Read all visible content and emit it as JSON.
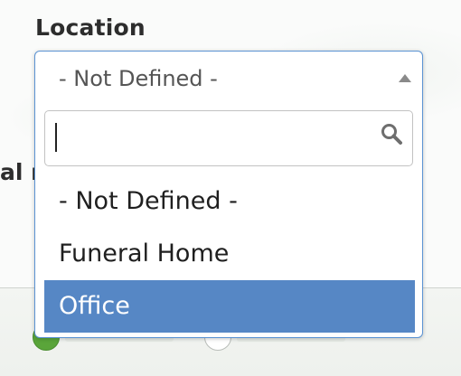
{
  "form": {
    "location_label": "Location",
    "partial_label": "al r"
  },
  "location_select": {
    "selected_value": "- Not Defined -",
    "search": {
      "value": "",
      "placeholder": ""
    },
    "options": [
      {
        "label": "- Not Defined -",
        "highlighted": false
      },
      {
        "label": "Funeral Home",
        "highlighted": false
      },
      {
        "label": "Office",
        "highlighted": true
      }
    ],
    "highlight_color": "#5687c5",
    "border_color": "#5b93d3"
  },
  "icons": {
    "dropdown_arrow": "triangle-up-icon",
    "search": "search-icon"
  },
  "colors": {
    "radio_selected": "#5aa53a"
  }
}
